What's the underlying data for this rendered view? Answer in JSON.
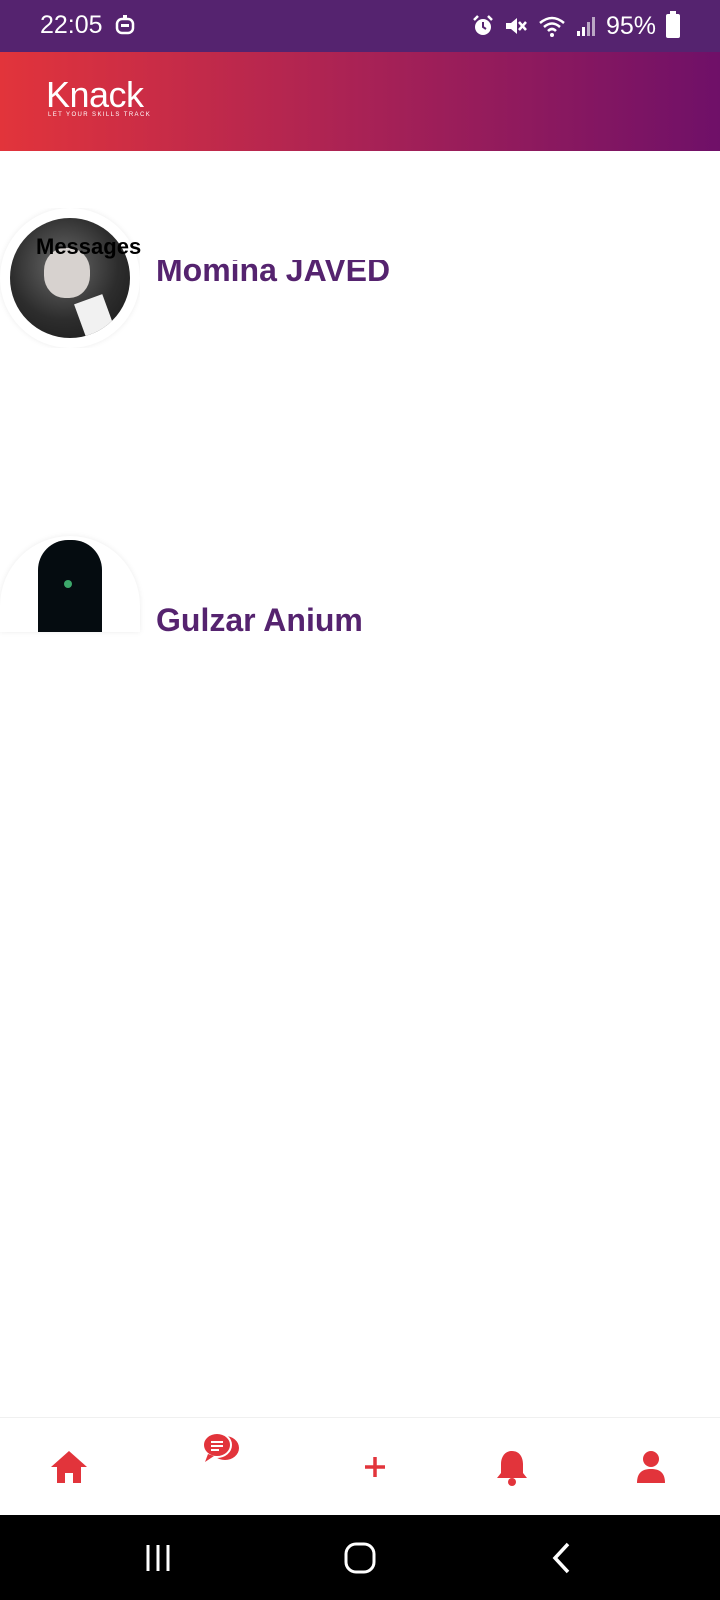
{
  "status_bar": {
    "time": "22:05",
    "battery_percent": "95%",
    "icons": [
      "alarm-icon",
      "mute-icon",
      "wifi-icon",
      "signal-icon",
      "battery-icon"
    ]
  },
  "app": {
    "logo_text": "Knack",
    "logo_tagline": "LET YOUR SKILLS TRACK",
    "accent_colors": {
      "red": "#e2343b",
      "purple": "#55236f",
      "magenta": "#6f1068"
    }
  },
  "page": {
    "title": "Messages"
  },
  "conversations": [
    {
      "name": "Momina JAVED"
    },
    {
      "name": "Gulzar Anium"
    }
  ],
  "bottom_nav": {
    "items": [
      {
        "icon": "home-icon"
      },
      {
        "icon": "chat-icon"
      },
      {
        "icon": "plus-icon"
      },
      {
        "icon": "bell-icon"
      },
      {
        "icon": "profile-icon"
      }
    ]
  },
  "system_nav": {
    "items": [
      "recents-icon",
      "home-circle-icon",
      "back-icon"
    ]
  }
}
